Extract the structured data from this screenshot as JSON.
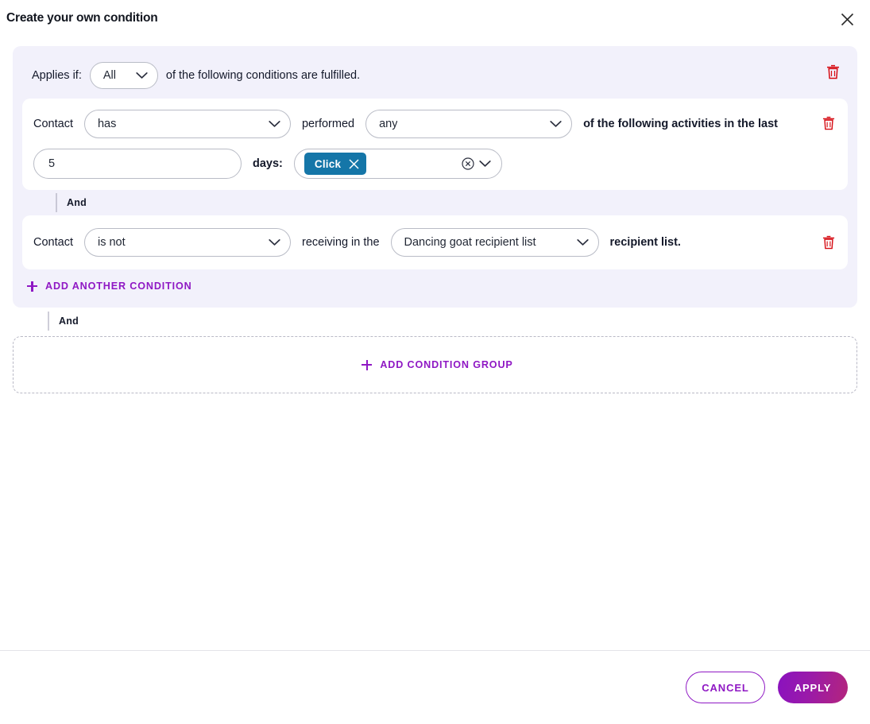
{
  "header": {
    "title": "Create your own condition",
    "close_icon": "close-icon"
  },
  "group": {
    "applies_label": "Applies if:",
    "applies_operator": "All",
    "applies_tail": "of the following conditions are fulfilled.",
    "delete_icon": "trash-icon",
    "add_another_condition": "ADD ANOTHER CONDITION",
    "inner_connector": "And"
  },
  "conditions": [
    {
      "subject": "Contact",
      "operator": "has",
      "verb": "performed",
      "quantifier": "any",
      "tail": "of the following activities in the last",
      "days_value": "5",
      "days_label": "days:",
      "activities": [
        {
          "label": "Click",
          "color": "#1576a8"
        }
      ],
      "clear_icon": "clear-circle-icon",
      "caret_icon": "chevron-down-icon",
      "delete_icon": "trash-icon"
    },
    {
      "subject": "Contact",
      "operator": "is not",
      "verb": "receiving in the",
      "list": "Dancing goat recipient list",
      "tail": "recipient list.",
      "delete_icon": "trash-icon"
    }
  ],
  "outer_connector": "And",
  "add_condition_group": "ADD CONDITION GROUP",
  "footer": {
    "cancel": "CANCEL",
    "apply": "APPLY"
  },
  "colors": {
    "accent_purple": "#8f18c4",
    "apply_gradient_start": "#8a12bf",
    "apply_gradient_end": "#b4257c",
    "chip_blue": "#1576a8",
    "trash_red": "#d60b12",
    "group_background": "#f2f1fb"
  }
}
